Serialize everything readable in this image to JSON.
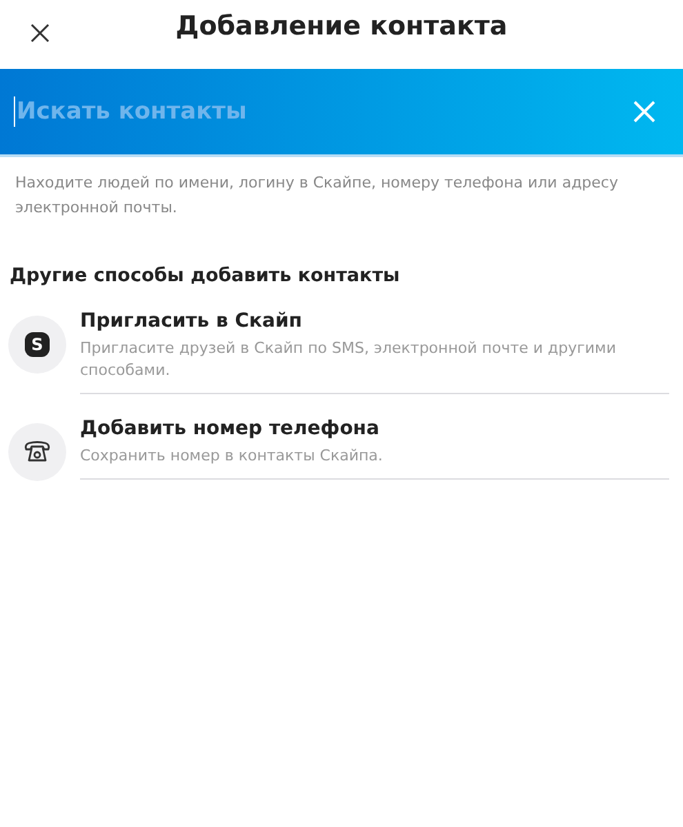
{
  "header": {
    "title": "Добавление контакта"
  },
  "search": {
    "placeholder": "Искать контакты"
  },
  "hint": "Находите людей по имени, логину в Скайпе, номеру телефона или адресу электронной почты.",
  "section": {
    "title": "Другие способы добавить контакты"
  },
  "options": [
    {
      "kind": "skype",
      "icon_letter": "S",
      "title": "Пригласить в Скайп",
      "subtitle": "Пригласите друзей в Скайп по SMS, электронной почте и другими способами."
    },
    {
      "kind": "phone",
      "title": "Добавить номер телефона",
      "subtitle": "Сохранить номер в контакты Скайпа."
    }
  ]
}
